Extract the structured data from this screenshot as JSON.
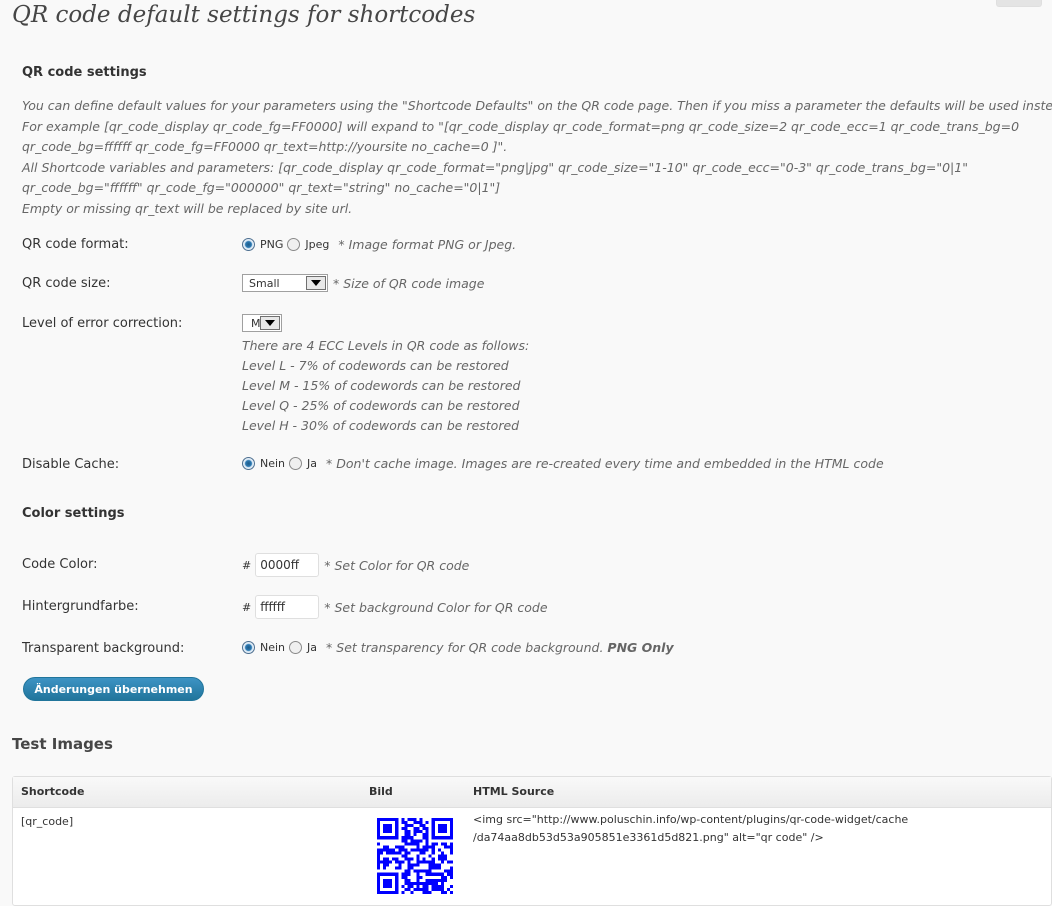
{
  "page": {
    "title": "QR code default settings for shortcodes"
  },
  "qr_settings": {
    "heading": "QR code settings",
    "description": [
      "You can define default values for your parameters using the \"Shortcode Defaults\" on the QR code page. Then if you miss a parameter the defaults will be used instead.",
      "For example [qr_code_display qr_code_fg=FF0000] will expand to \"[qr_code_display qr_code_format=png qr_code_size=2 qr_code_ecc=1 qr_code_trans_bg=0",
      "qr_code_bg=ffffff qr_code_fg=FF0000 qr_text=http://yoursite no_cache=0 ]\".",
      "All Shortcode variables and parameters: [qr_code_display qr_code_format=\"png|jpg\" qr_code_size=\"1-10\" qr_code_ecc=\"0-3\" qr_code_trans_bg=\"0|1\"",
      "qr_code_bg=\"ffffff\" qr_code_fg=\"000000\" qr_text=\"string\" no_cache=\"0|1\"]",
      "Empty or missing qr_text will be replaced by site url."
    ],
    "format": {
      "label": "QR code format:",
      "option_png": "PNG",
      "option_jpeg": "Jpeg",
      "selected": "PNG",
      "hint": "* Image format PNG or Jpeg."
    },
    "size": {
      "label": "QR code size:",
      "selected": "Small",
      "hint": "* Size of QR code image"
    },
    "ecc": {
      "label": "Level of error correction:",
      "selected": "M",
      "info": [
        "There are 4 ECC Levels in QR code as follows:",
        "Level L - 7% of codewords can be restored",
        "Level M - 15% of codewords can be restored",
        "Level Q - 25% of codewords can be restored",
        "Level H - 30% of codewords can be restored"
      ]
    },
    "cache": {
      "label": "Disable Cache:",
      "option_no": "Nein",
      "option_yes": "Ja",
      "selected": "Nein",
      "hint": "* Don't cache image. Images are re-created every time and embedded in the HTML code"
    }
  },
  "color_settings": {
    "heading": "Color settings",
    "code_color": {
      "label": "Code Color:",
      "prefix": "#",
      "value": "0000ff",
      "hint": "* Set Color for QR code"
    },
    "bg_color": {
      "label": "Hintergrundfarbe:",
      "prefix": "#",
      "value": "ffffff",
      "hint": "* Set background Color for QR code"
    },
    "transparent": {
      "label": "Transparent background:",
      "option_no": "Nein",
      "option_yes": "Ja",
      "selected": "Nein",
      "hint": "* Set transparency for QR code background.",
      "hint_bold": "PNG Only"
    }
  },
  "submit_label": "Änderungen übernehmen",
  "test_images": {
    "heading": "Test Images",
    "columns": [
      "Shortcode",
      "Bild",
      "HTML Source"
    ],
    "rows": [
      {
        "shortcode": "[qr_code]",
        "image_icon": "qr-code-image",
        "source_lines": [
          "<img src=\"http://www.poluschin.info/wp-content/plugins/qr-code-widget/cache",
          "/da74aa8db53d53a905851e3361d5d821.png\" alt=\"qr code\" />"
        ]
      }
    ]
  },
  "colors": {
    "qr_foreground": "#0000ff",
    "button": "#21759b",
    "background": "#f9f9f9"
  }
}
